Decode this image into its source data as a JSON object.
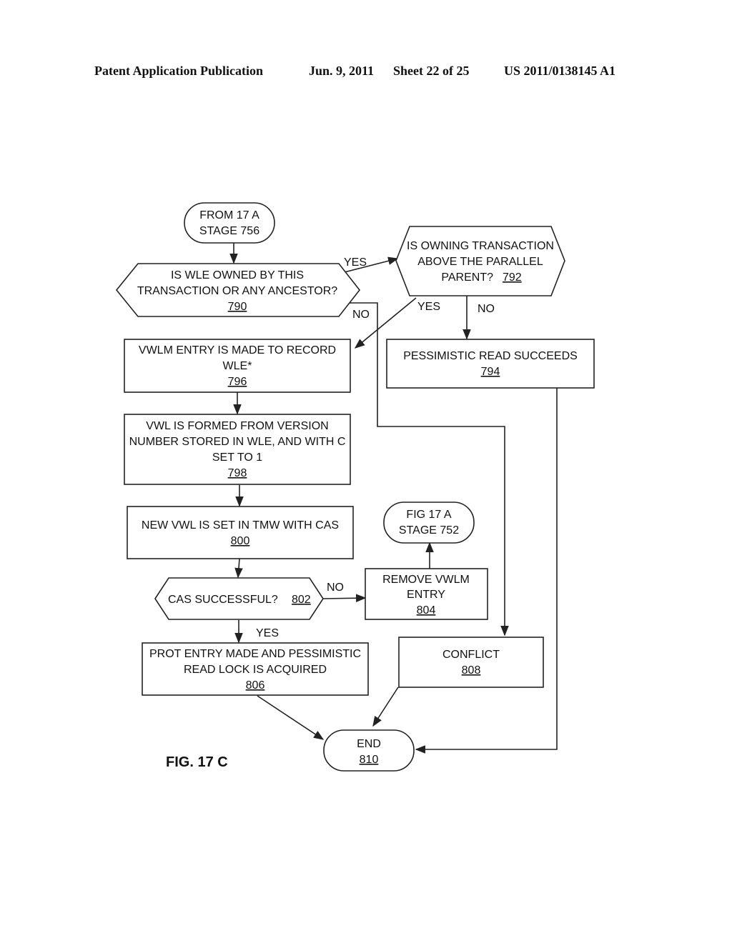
{
  "header": {
    "publication": "Patent Application Publication",
    "date": "Jun. 9, 2011",
    "sheet": "Sheet 22 of 25",
    "number": "US 2011/0138145 A1"
  },
  "figure_label": "FIG. 17 C",
  "nodes": {
    "start": {
      "lines": [
        "FROM 17 A",
        "STAGE 756"
      ],
      "ref": ""
    },
    "n790": {
      "lines": [
        "IS WLE OWNED BY THIS",
        "TRANSACTION OR ANY ANCESTOR?"
      ],
      "ref": "790"
    },
    "n792": {
      "lines": [
        "IS OWNING TRANSACTION",
        "ABOVE THE PARALLEL",
        "PARENT?"
      ],
      "ref": "792"
    },
    "n794": {
      "lines": [
        "PESSIMISTIC READ SUCCEEDS"
      ],
      "ref": "794"
    },
    "n796": {
      "lines": [
        "VWLM ENTRY IS MADE TO RECORD",
        "WLE*"
      ],
      "ref": "796"
    },
    "n798": {
      "lines": [
        "VWL IS FORMED FROM VERSION",
        "NUMBER STORED IN WLE, AND WITH C",
        "SET TO 1"
      ],
      "ref": "798"
    },
    "n800": {
      "lines": [
        "NEW VWL IS SET IN TMW WITH CAS"
      ],
      "ref": "800"
    },
    "n802": {
      "lines": [
        "CAS SUCCESSFUL?"
      ],
      "ref": "802"
    },
    "n804": {
      "lines": [
        "REMOVE VWLM",
        "ENTRY"
      ],
      "ref": "804"
    },
    "fig17a": {
      "lines": [
        "FIG 17 A",
        "STAGE 752"
      ],
      "ref": ""
    },
    "n806": {
      "lines": [
        "PROT ENTRY MADE AND PESSIMISTIC",
        "READ LOCK IS ACQUIRED"
      ],
      "ref": "806"
    },
    "n808": {
      "lines": [
        "CONFLICT"
      ],
      "ref": "808"
    },
    "n810": {
      "lines": [
        "END"
      ],
      "ref": "810"
    }
  },
  "edge_labels": {
    "e790_yes": "YES",
    "e790_no": "NO",
    "e792_yes": "YES",
    "e792_no": "NO",
    "e802_no": "NO",
    "e802_yes": "YES"
  }
}
